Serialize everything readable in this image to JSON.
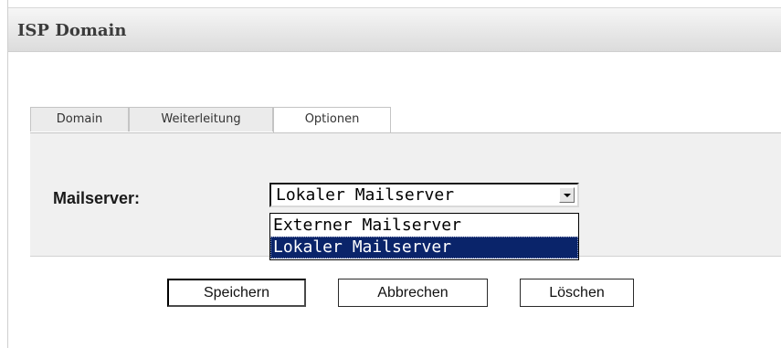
{
  "panel": {
    "title": "ISP Domain"
  },
  "tabs": [
    {
      "label": "Domain",
      "active": false
    },
    {
      "label": "Weiterleitung",
      "active": false
    },
    {
      "label": "Optionen",
      "active": true
    }
  ],
  "form": {
    "mailserver_label": "Mailserver:",
    "mailserver_select": {
      "selected": "Lokaler Mailserver",
      "expanded": true,
      "options": [
        {
          "label": "Externer Mailserver",
          "highlighted": false
        },
        {
          "label": "Lokaler Mailserver",
          "highlighted": true
        }
      ]
    }
  },
  "buttons": {
    "save_label": "Speichern",
    "cancel_label": "Abbrechen",
    "delete_label": "Löschen"
  },
  "colors": {
    "header_bg": "#e6e6e6",
    "tab_body_bg": "#f0f0f0",
    "highlight_bg": "#0a246a",
    "highlight_text": "#ffffff"
  },
  "icons": {
    "dropdown_arrow": "chevron-down-icon"
  }
}
